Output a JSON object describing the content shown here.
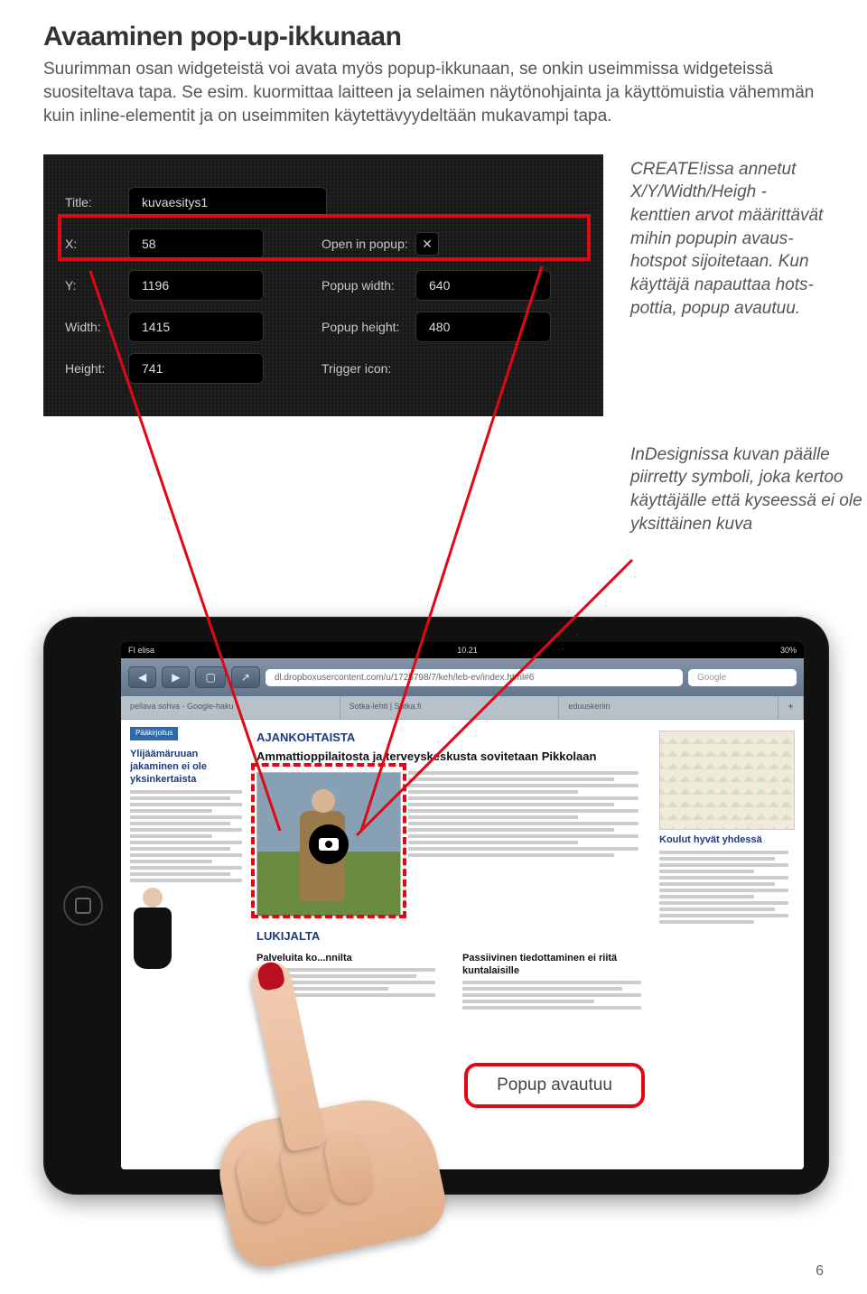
{
  "page": {
    "title": "Avaaminen pop-up-ikkunaan",
    "intro": "Suurimman osan widgeteistä voi avata myös popup-ikkunaan, se onkin useimmissa widgeteissä suositeltava tapa. Se esim. kuormittaa laitteen ja selaimen näytönohjainta ja käyttömuistia vähemmän kuin inline-elementit ja on useimmiten käytettävyydeltään mukavampi tapa.",
    "page_number": "6"
  },
  "create_panel": {
    "title_label": "Title:",
    "title_value": "kuvaesitys1",
    "x_label": "X:",
    "x_value": "58",
    "y_label": "Y:",
    "y_value": "1196",
    "width_label": "Width:",
    "width_value": "1415",
    "height_label": "Height:",
    "height_value": "741",
    "open_label": "Open in popup:",
    "open_checked": "✕",
    "popup_w_label": "Popup width:",
    "popup_w_value": "640",
    "popup_h_label": "Popup height:",
    "popup_h_value": "480",
    "trigger_label": "Trigger icon:"
  },
  "aside1": "CREATE!issa annetut X/Y/Width/Heigh -kenttien arvot määrittävät mihin popupin avaus­hotspot sijoitetaan. Kun käyttäjä napauttaa hots­pottia, popup avautuu.",
  "aside2": "InDesignissa kuvan päälle piirretty symboli, joka kertoo käyttäjälle että kyseessä ei ole yksittäinen kuva",
  "ipad": {
    "status_left": "FI elisa",
    "status_mid": "10.21",
    "status_right": "30%",
    "nav_back": "◀",
    "nav_fwd": "▶",
    "nav_book": "▢",
    "nav_share": "↗",
    "url": "dl.dropboxusercontent.com/u/1725798/7/keh/leb-ev/index.html#6",
    "search_placeholder": "Google",
    "tabs": [
      "pellava sohva - Google-haku",
      "Sotka-lehti | Sotka.fi",
      "eduuskeriin"
    ],
    "plus": "+"
  },
  "news": {
    "tag1": "Pääkirjoitus",
    "left_head": "Ylijäämäruuan jakaminen ei ole yksinkertaista",
    "tag2": "AJANKOHTAISTA",
    "main_head": "Ammattioppilaitosta ja terveyskeskusta sovitetaan Pikkolaan",
    "right_head": "Koulut hyvät yhdessä",
    "section2": "LUKIJALTA",
    "sec2a": "Palveluita ko...nnilta",
    "sec2b": "Passiivinen tiedottaminen ei riitä kuntalaisille"
  },
  "popup_label": "Popup avautuu"
}
